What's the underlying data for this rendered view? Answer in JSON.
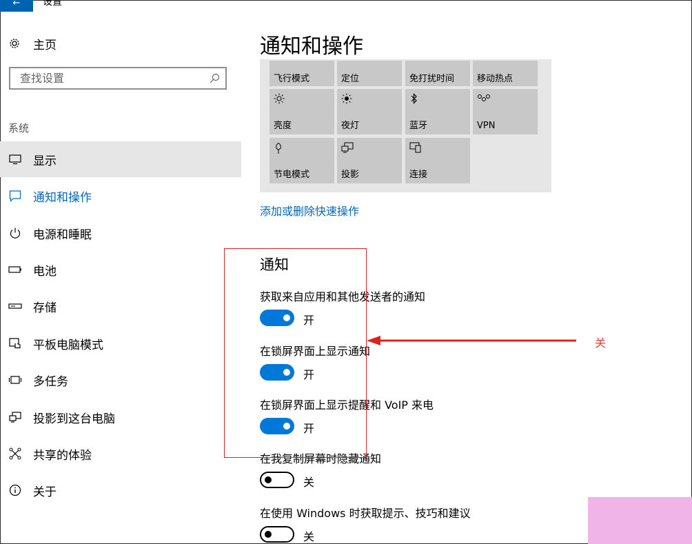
{
  "window": {
    "back_glyph": "←",
    "title": "设置"
  },
  "sidebar": {
    "home_label": "主页",
    "search_placeholder": "查找设置",
    "section_label": "系统",
    "items": [
      {
        "label": "显示",
        "icon": "monitor-icon"
      },
      {
        "label": "通知和操作",
        "icon": "message-icon"
      },
      {
        "label": "电源和睡眠",
        "icon": "power-icon"
      },
      {
        "label": "电池",
        "icon": "battery-icon"
      },
      {
        "label": "存储",
        "icon": "storage-icon"
      },
      {
        "label": "平板电脑模式",
        "icon": "tablet-icon"
      },
      {
        "label": "多任务",
        "icon": "multitask-icon"
      },
      {
        "label": "投影到这台电脑",
        "icon": "project-icon"
      },
      {
        "label": "共享的体验",
        "icon": "share-icon"
      },
      {
        "label": "关于",
        "icon": "info-icon"
      }
    ]
  },
  "main": {
    "title": "通知和操作",
    "quick_actions": [
      {
        "label": "飞行模式"
      },
      {
        "label": "定位"
      },
      {
        "label": "免打扰时间"
      },
      {
        "label": "移动热点"
      },
      {
        "label": "亮度",
        "icon": "brightness-icon"
      },
      {
        "label": "夜灯",
        "icon": "night-light-icon"
      },
      {
        "label": "蓝牙",
        "icon": "bluetooth-icon"
      },
      {
        "label": "VPN",
        "icon": "vpn-icon"
      },
      {
        "label": "节电模式",
        "icon": "battery-saver-icon"
      },
      {
        "label": "投影",
        "icon": "project-icon"
      },
      {
        "label": "连接",
        "icon": "connect-icon"
      }
    ],
    "add_remove_link": "添加或删除快速操作",
    "notifications_heading": "通知",
    "settings": [
      {
        "label": "获取来自应用和其他发送者的通知",
        "state": "开",
        "on": true
      },
      {
        "label": "在锁屏界面上显示通知",
        "state": "开",
        "on": true
      },
      {
        "label": "在锁屏界面上显示提醒和 VoIP 来电",
        "state": "开",
        "on": true
      },
      {
        "label": "在我复制屏幕时隐藏通知",
        "state": "关",
        "on": false
      },
      {
        "label": "在使用 Windows 时获取提示、技巧和建议",
        "state": "关",
        "on": false
      }
    ]
  },
  "annotation": {
    "text": "关",
    "color": "#e02020"
  },
  "colors": {
    "accent": "#0078d7",
    "link": "#0067c0"
  }
}
